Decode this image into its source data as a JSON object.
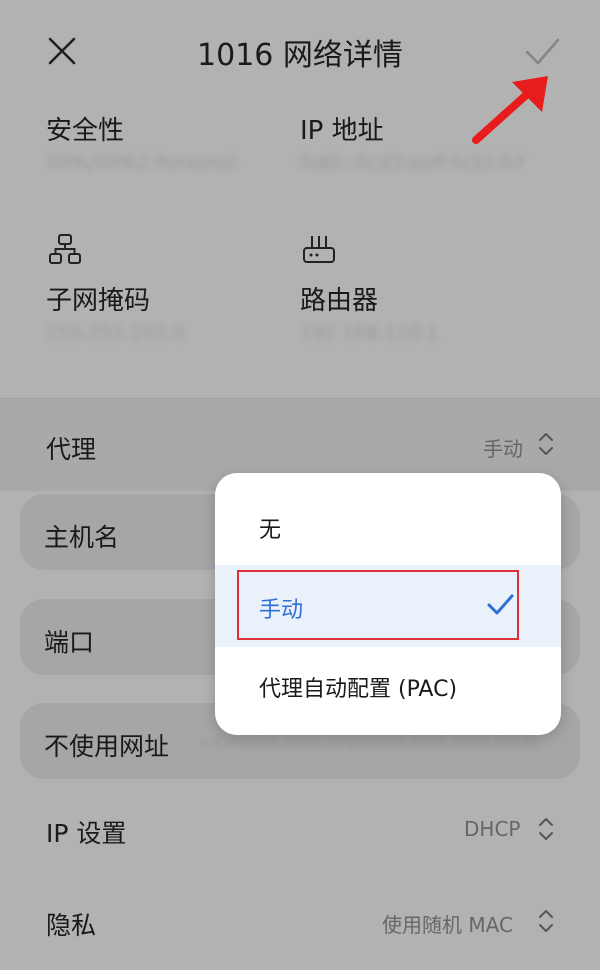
{
  "header": {
    "title": "1016 网络详情"
  },
  "info": {
    "security": {
      "label": "安全性",
      "value": "WPA/WPA2-Personal"
    },
    "ip": {
      "label": "IP 地址",
      "value": "fe80::4cd3:eeff:fe32:fcf"
    },
    "subnet": {
      "label": "子网掩码",
      "value": "255.255.255.0"
    },
    "router": {
      "label": "路由器",
      "value": "192.168.110.1"
    }
  },
  "proxy": {
    "label": "代理",
    "value": "手动"
  },
  "fields": {
    "hostname": {
      "label": "主机名"
    },
    "port": {
      "label": "端口"
    },
    "bypass": {
      "label": "不使用网址",
      "value": "example.com,mycomp.test.com,local"
    }
  },
  "ip_settings": {
    "label": "IP 设置",
    "value": "DHCP"
  },
  "privacy": {
    "label": "隐私",
    "value": "使用随机 MAC"
  },
  "popup": {
    "options": [
      "无",
      "手动",
      "代理自动配置 (PAC)"
    ],
    "selected_index": 1
  },
  "colors": {
    "accent": "#2f6fd6",
    "annotation_red": "#e0303a"
  }
}
